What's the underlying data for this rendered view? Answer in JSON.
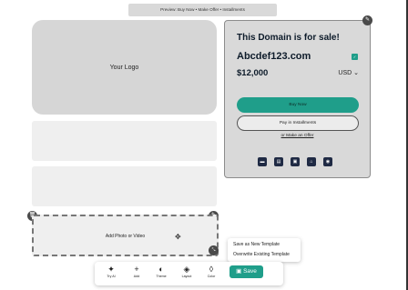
{
  "banner": {
    "text": "Preview: Buy Now • Make Offer • Installments"
  },
  "logo_box": {
    "label": "Your Logo"
  },
  "media_box": {
    "label": "Add Photo or Video"
  },
  "domain_card": {
    "title": "This Domain is for sale!",
    "domain": "Abcdef123.com",
    "price": "$12,000",
    "currency": "USD",
    "buy_now": "Buy Now",
    "installments": "Pay in Installments",
    "offer": "or Make an Offer"
  },
  "save_menu": {
    "items": [
      "Save as New Template",
      "Overwrite Existing Template"
    ]
  },
  "toolbar": {
    "tools": [
      {
        "icon": "sparkle-icon",
        "label": "Try AI"
      },
      {
        "icon": "plus-icon",
        "label": "Add"
      },
      {
        "icon": "palette-icon",
        "label": "Theme"
      },
      {
        "icon": "layers-icon",
        "label": "Layout"
      },
      {
        "icon": "drop-icon",
        "label": "Color"
      }
    ],
    "save_label": "Save"
  },
  "colors": {
    "accent": "#1f9e8a",
    "card_bg": "#d9d9d9",
    "placeholder_bg": "#efefef",
    "logo_bg": "#d6d6d6"
  }
}
